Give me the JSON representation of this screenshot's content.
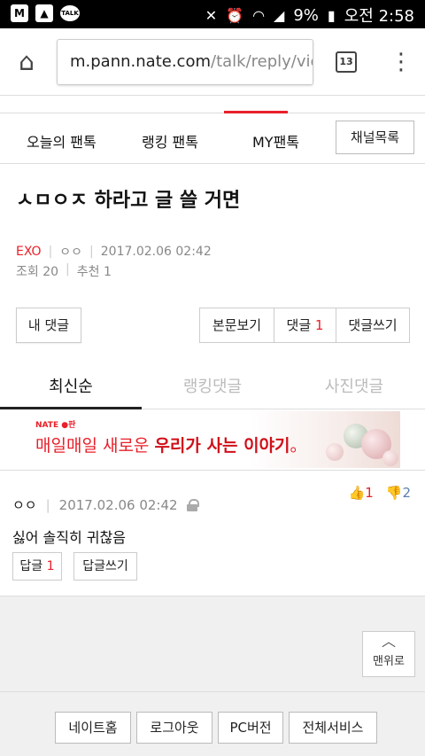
{
  "status_bar": {
    "carrier_icon": "M",
    "talk_icon": "TALK",
    "battery": "9%",
    "time": "오전 2:58"
  },
  "browser": {
    "url_host": "m.pann.nate.com",
    "url_path": "/talk/reply/vie",
    "tab_count": "13"
  },
  "nav": {
    "tab_today": "오늘의 팬톡",
    "tab_ranking": "랭킹 팬톡",
    "tab_my": "MY팬톡",
    "channel_list": "채널목록"
  },
  "post": {
    "title": "ㅅㅁㅇㅈ 하라고 글 쓸 거면",
    "category": "EXO",
    "author": "ㅇㅇ",
    "date": "2017.02.06 02:42",
    "views": "조회 20",
    "recommend": "추천 1"
  },
  "actions": {
    "my_comments": "내 댓글",
    "view_body": "본문보기",
    "comments_label": "댓글",
    "comments_count": "1",
    "write_comment": "댓글쓰기"
  },
  "sort_tabs": [
    "최신순",
    "랭킹댓글",
    "사진댓글"
  ],
  "banner": {
    "brand": "NATE ●판",
    "tagline_a": "매일매일 새로운",
    "tagline_b": "우리가 사는 이야기",
    "tagline_c": "。"
  },
  "comment": {
    "author": "ㅇㅇ",
    "date": "2017.02.06 02:42",
    "text": "싫어 솔직히 귀찮음",
    "up": "1",
    "down": "2",
    "reply_label": "답글",
    "reply_count": "1",
    "write_reply": "답글쓰기"
  },
  "scroll_top": {
    "arrow": "︿",
    "label": "맨위로"
  },
  "footer": [
    "네이트홈",
    "로그아웃",
    "PC버전",
    "전체서비스"
  ],
  "colors": {
    "accent": "#e8202a",
    "down_vote": "#5b7fb0"
  }
}
